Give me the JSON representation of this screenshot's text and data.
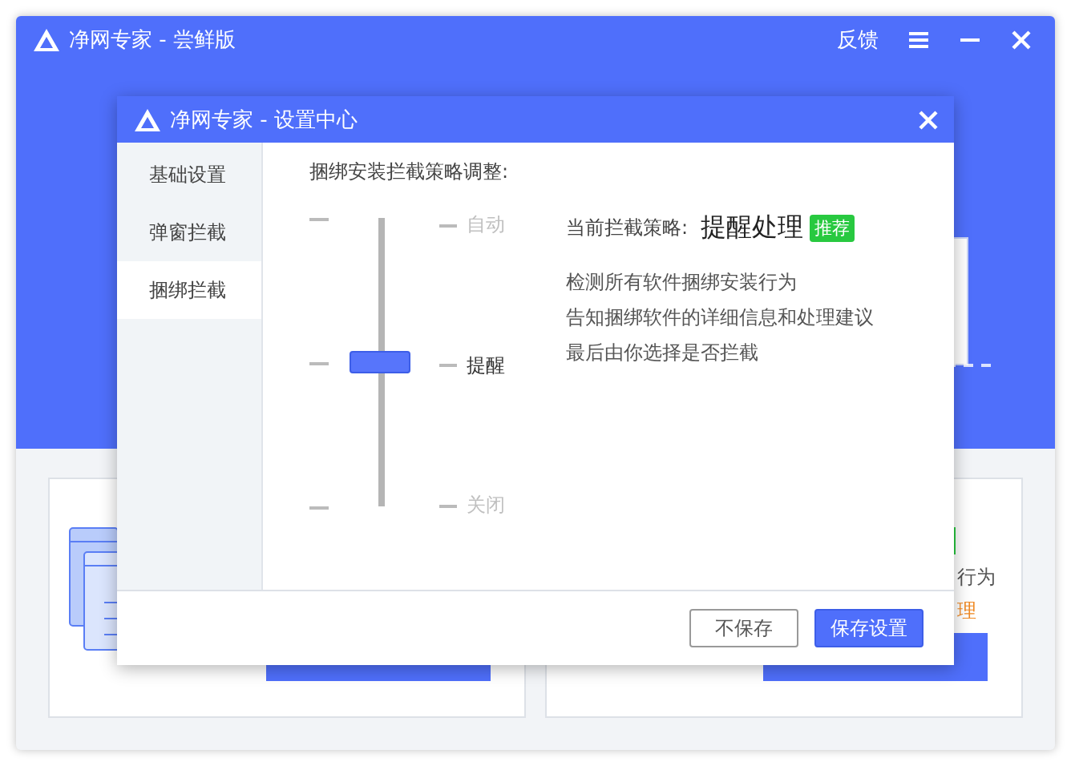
{
  "window": {
    "title": "净网专家 - 尝鲜版",
    "actions": [
      {
        "kind": "text",
        "label": "反馈"
      },
      {
        "kind": "menu"
      },
      {
        "kind": "minimize"
      },
      {
        "kind": "close"
      }
    ]
  },
  "background_card": {
    "line": "行为",
    "highlight": "理"
  },
  "dialog": {
    "title": "净网专家 - 设置中心",
    "sidebar": [
      {
        "label": "基础设置",
        "selected": false
      },
      {
        "label": "弹窗拦截",
        "selected": false
      },
      {
        "label": "捆绑拦截",
        "selected": true
      }
    ],
    "heading": "捆绑安装拦截策略调整:",
    "slider": {
      "level": 0.5,
      "stops": [
        {
          "label": "自动",
          "selected": false
        },
        {
          "label": "提醒",
          "selected": true
        },
        {
          "label": "关闭",
          "selected": false
        }
      ]
    },
    "current": {
      "label": "当前拦截策略:",
      "value": "提醒处理",
      "badge": "推荐"
    },
    "description": [
      "检测所有软件捆绑安装行为",
      "告知捆绑软件的详细信息和处理建议",
      "最后由你选择是否拦截"
    ],
    "buttons": [
      {
        "kind": "secondary",
        "label": "不保存"
      },
      {
        "kind": "primary",
        "label": "保存设置"
      }
    ]
  }
}
